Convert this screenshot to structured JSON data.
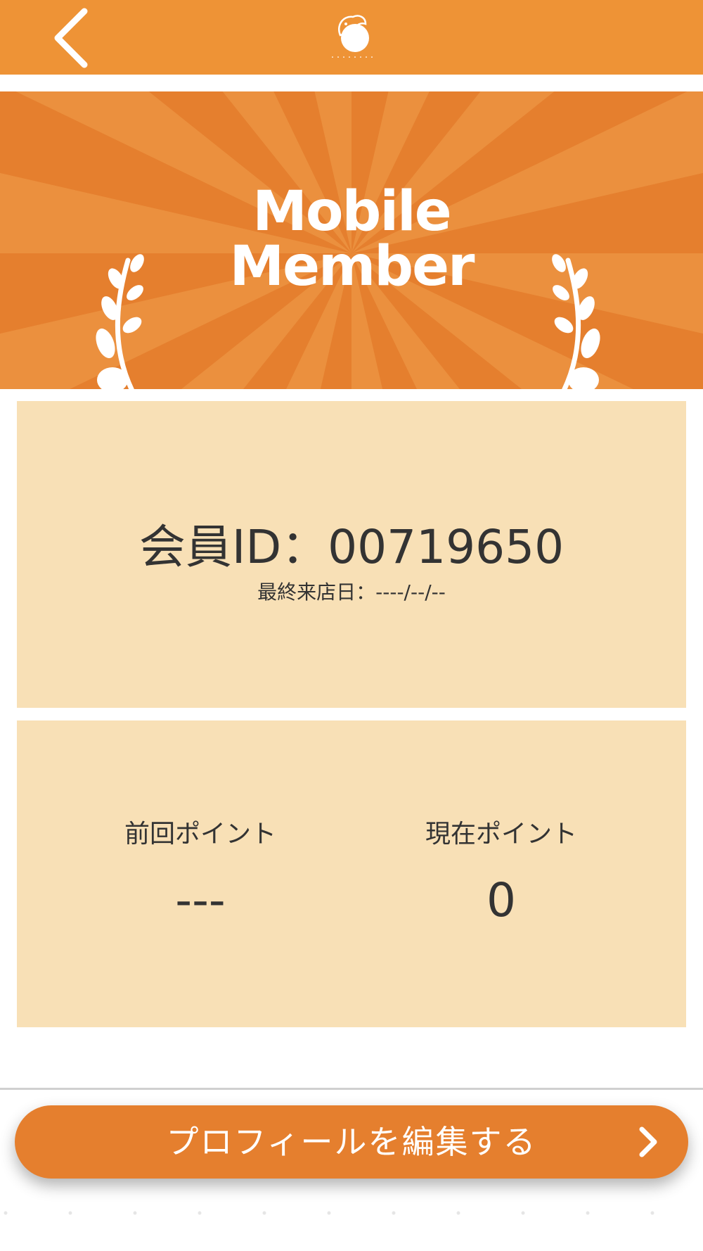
{
  "header": {
    "back_icon": "chevron-left-icon",
    "logo_icon": "bird-logo-icon"
  },
  "banner": {
    "title_line1": "Mobile",
    "title_line2": "Member",
    "decoration_icon": "laurel-branch-icon"
  },
  "member_card": {
    "id_text": "会員ID：00719650",
    "last_visit_text": "最終来店日：----/--/--"
  },
  "points_card": {
    "previous_label": "前回ポイント",
    "previous_value": "---",
    "current_label": "現在ポイント",
    "current_value": "0"
  },
  "action": {
    "edit_profile_label": "プロフィールを編集する",
    "arrow_icon": "chevron-right-icon"
  },
  "colors": {
    "header": "#ee9336",
    "banner": "#e57f2e",
    "card": "#f8e0b6",
    "button": "#e57f2e",
    "text": "#333333"
  }
}
